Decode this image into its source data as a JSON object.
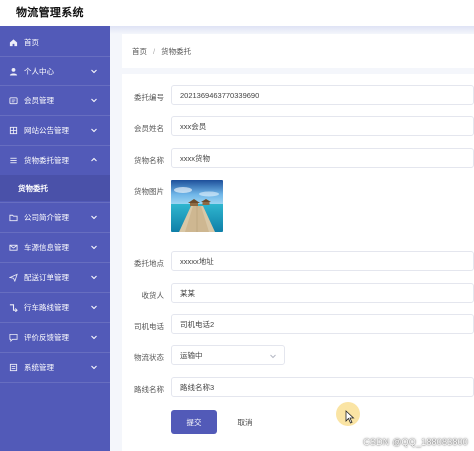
{
  "app": {
    "title": "物流管理系统"
  },
  "sidebar": {
    "items": [
      {
        "label": "首页",
        "icon": "home-icon"
      },
      {
        "label": "个人中心",
        "icon": "user-icon"
      },
      {
        "label": "会员管理",
        "icon": "member-icon"
      },
      {
        "label": "网站公告管理",
        "icon": "notice-icon"
      },
      {
        "label": "货物委托管理",
        "icon": "list-icon",
        "expanded": true
      },
      {
        "label": "公司简介管理",
        "icon": "folder-icon"
      },
      {
        "label": "车源信息管理",
        "icon": "mail-icon"
      },
      {
        "label": "配送订单管理",
        "icon": "send-icon"
      },
      {
        "label": "行车路线管理",
        "icon": "route-icon"
      },
      {
        "label": "评价反馈管理",
        "icon": "comment-icon"
      },
      {
        "label": "系统管理",
        "icon": "settings-icon"
      }
    ],
    "sub_item": {
      "label": "货物委托"
    }
  },
  "breadcrumb": {
    "home": "首页",
    "separator": "/",
    "current": "货物委托"
  },
  "form": {
    "fields": {
      "order_no": {
        "label": "委托编号",
        "value": "2021369463770339690"
      },
      "member_name": {
        "label": "会员姓名",
        "value": "xxx会员"
      },
      "goods_name": {
        "label": "货物名称",
        "value": "xxxx货物"
      },
      "goods_image": {
        "label": "货物图片"
      },
      "address": {
        "label": "委托地点",
        "value": "xxxxx地址"
      },
      "receiver": {
        "label": "收货人",
        "value": "某某"
      },
      "driver_phone": {
        "label": "司机电话",
        "value": "司机电话2"
      },
      "status": {
        "label": "物流状态",
        "value": "运输中"
      },
      "route_name": {
        "label": "路线名称",
        "value": "路线名称3"
      }
    },
    "submit_label": "提交",
    "cancel_label": "取消"
  },
  "watermark": "CSDN @QQ_188083800",
  "colors": {
    "sidebar": "#525ab8",
    "accent": "#525ab8",
    "background": "#f4f6fb"
  }
}
